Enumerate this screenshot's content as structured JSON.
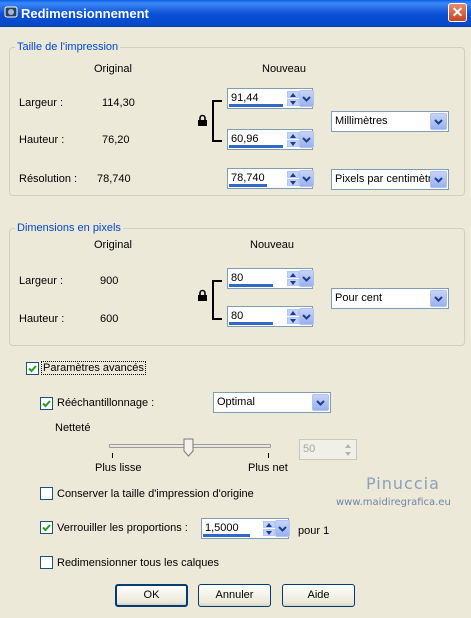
{
  "window": {
    "title": "Redimensionnement",
    "close": "✕"
  },
  "print_size": {
    "legend": "Taille de l'impression",
    "col_original": "Original",
    "col_new": "Nouveau",
    "width_label": "Largeur :",
    "width_original": "114,30",
    "width_new": "91,44",
    "height_label": "Hauteur :",
    "height_original": "76,20",
    "height_new": "60,96",
    "units": "Millimètres",
    "resolution_label": "Résolution :",
    "resolution_original": "78,740",
    "resolution_new": "78,740",
    "resolution_units": "Pixels par centimètre"
  },
  "pixel_size": {
    "legend": "Dimensions en pixels",
    "col_original": "Original",
    "col_new": "Nouveau",
    "width_label": "Largeur :",
    "width_original": "900",
    "width_new": "80",
    "height_label": "Hauteur :",
    "height_original": "600",
    "height_new": "80",
    "units": "Pour cent"
  },
  "advanced": {
    "label": "Paramètres avancés",
    "checked": true,
    "resample_label": "Rééchantillonnage :",
    "resample_checked": true,
    "resample_value": "Optimal",
    "sharpness_label": "Netteté",
    "sharpness_value": "50",
    "slider_min_label": "Plus lisse",
    "slider_max_label": "Plus net",
    "keep_print_size_label": "Conserver la taille d'impression d'origine",
    "keep_print_size_checked": false,
    "lock_ratio_label": "Verrouiller les proportions :",
    "lock_ratio_checked": true,
    "ratio_value": "1,5000",
    "ratio_suffix": "pour 1",
    "resize_all_layers_label": "Redimensionner tous les calques",
    "resize_all_layers_checked": false
  },
  "buttons": {
    "ok": "OK",
    "cancel": "Annuler",
    "help": "Aide"
  },
  "watermark": {
    "line1": "Pinuccia",
    "line2": "www.maidiregrafica.eu"
  },
  "icons": {
    "app": "app-icon",
    "lock": "lock-icon",
    "spin": "spin-arrows-icon",
    "dropdown": "chevron-down-icon",
    "check": "checkmark-icon"
  }
}
